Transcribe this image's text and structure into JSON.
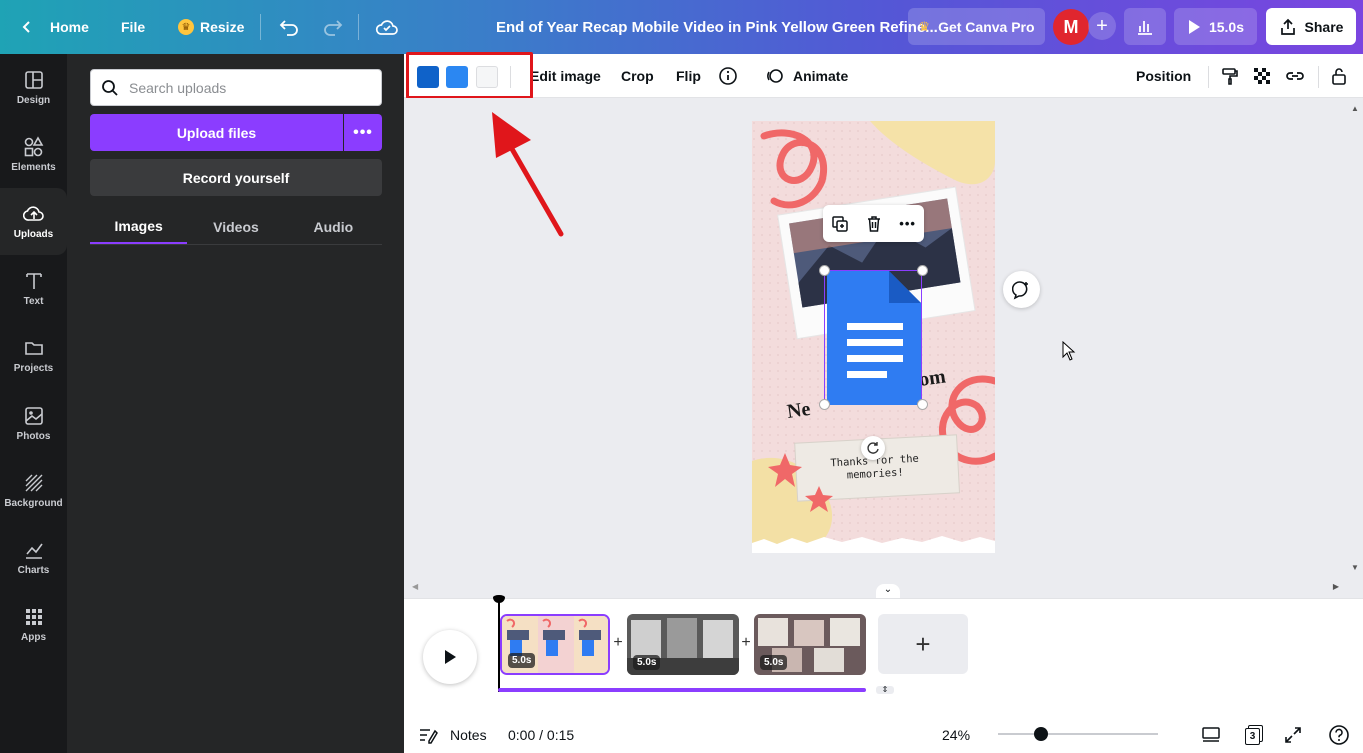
{
  "topbar": {
    "home": "Home",
    "file": "File",
    "resize": "Resize",
    "doc_title": "End of Year Recap Mobile Video in Pink Yellow Green Refine...",
    "get_pro": "Get Canva Pro",
    "avatar_initial": "M",
    "play_duration": "15.0s",
    "share": "Share"
  },
  "rail": {
    "items": [
      {
        "label": "Design",
        "icon": "design-icon"
      },
      {
        "label": "Elements",
        "icon": "elements-icon"
      },
      {
        "label": "Uploads",
        "icon": "uploads-icon"
      },
      {
        "label": "Text",
        "icon": "text-icon"
      },
      {
        "label": "Projects",
        "icon": "folder-icon"
      },
      {
        "label": "Photos",
        "icon": "photos-icon"
      },
      {
        "label": "Background",
        "icon": "background-icon"
      },
      {
        "label": "Charts",
        "icon": "charts-icon"
      },
      {
        "label": "Apps",
        "icon": "apps-icon"
      }
    ]
  },
  "panel": {
    "search_placeholder": "Search uploads",
    "upload_files": "Upload files",
    "record": "Record yourself",
    "tabs": [
      "Images",
      "Videos",
      "Audio"
    ]
  },
  "toolbar": {
    "colors": [
      "#0f62c9",
      "#2b87f2",
      "#f5f6f7"
    ],
    "edit_image": "Edit image",
    "crop": "Crop",
    "flip": "Flip",
    "animate": "Animate",
    "position": "Position"
  },
  "canvas": {
    "thanks_text": "Thanks for the memories!",
    "partial_heading_left": "Ne",
    "partial_heading_right": "om"
  },
  "timeline": {
    "clips": [
      {
        "duration": "5.0s"
      },
      {
        "duration": "5.0s"
      },
      {
        "duration": "5.0s"
      }
    ]
  },
  "footer": {
    "notes": "Notes",
    "time": "0:00 / 0:15",
    "zoom": "24%",
    "page_count": "3"
  }
}
